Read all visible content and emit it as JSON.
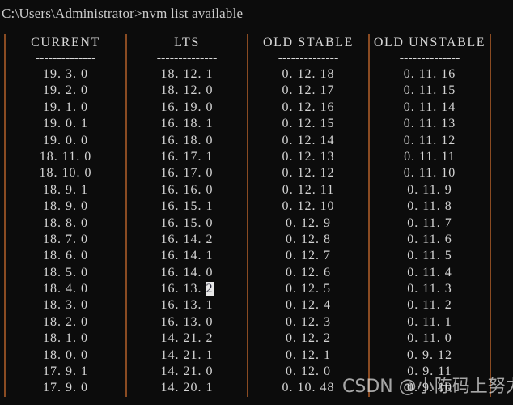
{
  "terminal": {
    "prompt_line": "C:\\Users\\Administrator>nvm list available",
    "background_color": "#0c0c0c",
    "text_color": "#d4d4d4",
    "separator_color": "#8a4b22",
    "cursor_color": "#e8e8e8"
  },
  "table": {
    "headers": [
      "CURRENT",
      "LTS",
      "OLD STABLE",
      "OLD UNSTABLE"
    ],
    "rule": "--------------",
    "columns": {
      "current": [
        "19. 3. 0",
        "19. 2. 0",
        "19. 1. 0",
        "19. 0. 1",
        "19. 0. 0",
        "18. 11. 0",
        "18. 10. 0",
        "18. 9. 1",
        "18. 9. 0",
        "18. 8. 0",
        "18. 7. 0",
        "18. 6. 0",
        "18. 5. 0",
        "18. 4. 0",
        "18. 3. 0",
        "18. 2. 0",
        "18. 1. 0",
        "18. 0. 0",
        "17. 9. 1",
        "17. 9. 0"
      ],
      "lts": [
        "18. 12. 1",
        "18. 12. 0",
        "16. 19. 0",
        "16. 18. 1",
        "16. 18. 0",
        "16. 17. 1",
        "16. 17. 0",
        "16. 16. 0",
        "16. 15. 1",
        "16. 15. 0",
        "16. 14. 2",
        "16. 14. 1",
        "16. 14. 0",
        "16. 13. 2",
        "16. 13. 1",
        "16. 13. 0",
        "14. 21. 2",
        "14. 21. 1",
        "14. 21. 0",
        "14. 20. 1"
      ],
      "old_stable": [
        "0. 12. 18",
        "0. 12. 17",
        "0. 12. 16",
        "0. 12. 15",
        "0. 12. 14",
        "0. 12. 13",
        "0. 12. 12",
        "0. 12. 11",
        "0. 12. 10",
        "0. 12. 9",
        "0. 12. 8",
        "0. 12. 7",
        "0. 12. 6",
        "0. 12. 5",
        "0. 12. 4",
        "0. 12. 3",
        "0. 12. 2",
        "0. 12. 1",
        "0. 12. 0",
        "0. 10. 48"
      ],
      "old_unstable": [
        "0. 11. 16",
        "0. 11. 15",
        "0. 11. 14",
        "0. 11. 13",
        "0. 11. 12",
        "0. 11. 11",
        "0. 11. 10",
        "0. 11. 9",
        "0. 11. 8",
        "0. 11. 7",
        "0. 11. 6",
        "0. 11. 5",
        "0. 11. 4",
        "0. 11. 3",
        "0. 11. 2",
        "0. 11. 1",
        "0. 11. 0",
        "0. 9. 12",
        "0. 9. 11",
        "0. 9. 10"
      ]
    },
    "cursor": {
      "column": "lts",
      "row_index": 13,
      "highlighted_text": "2"
    }
  },
  "watermark": {
    "text": "CSDN @小陈码上努力"
  }
}
